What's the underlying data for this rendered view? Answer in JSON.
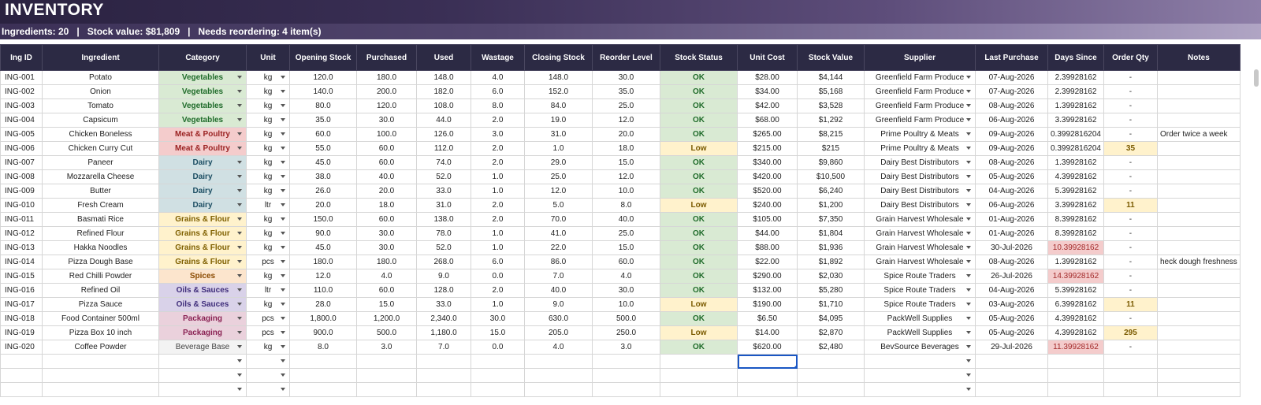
{
  "header": {
    "title": "INVENTORY",
    "summary": "Ingredients: 20   |   Stock value: $81,809   |   Needs reordering: 4 item(s)"
  },
  "columns": [
    "Ing ID",
    "Ingredient",
    "Category",
    "Unit",
    "Opening Stock",
    "Purchased",
    "Used",
    "Wastage",
    "Closing Stock",
    "Reorder Level",
    "Stock Status",
    "Unit Cost",
    "Stock Value",
    "Supplier",
    "Last Purchase",
    "Days Since",
    "Order Qty",
    "Notes"
  ],
  "rows": [
    {
      "id": "ING-001",
      "name": "Potato",
      "category": "Vegetables",
      "unit": "kg",
      "opening": "120.0",
      "purchased": "180.0",
      "used": "148.0",
      "wastage": "4.0",
      "closing": "148.0",
      "reorder": "30.0",
      "status": "OK",
      "cost": "$28.00",
      "value": "$4,144",
      "supplier": "Greenfield Farm Produce",
      "last": "07-Aug-2026",
      "days": "2.39928162",
      "order": "-",
      "notes": ""
    },
    {
      "id": "ING-002",
      "name": "Onion",
      "category": "Vegetables",
      "unit": "kg",
      "opening": "140.0",
      "purchased": "200.0",
      "used": "182.0",
      "wastage": "6.0",
      "closing": "152.0",
      "reorder": "35.0",
      "status": "OK",
      "cost": "$34.00",
      "value": "$5,168",
      "supplier": "Greenfield Farm Produce",
      "last": "07-Aug-2026",
      "days": "2.39928162",
      "order": "-",
      "notes": ""
    },
    {
      "id": "ING-003",
      "name": "Tomato",
      "category": "Vegetables",
      "unit": "kg",
      "opening": "80.0",
      "purchased": "120.0",
      "used": "108.0",
      "wastage": "8.0",
      "closing": "84.0",
      "reorder": "25.0",
      "status": "OK",
      "cost": "$42.00",
      "value": "$3,528",
      "supplier": "Greenfield Farm Produce",
      "last": "08-Aug-2026",
      "days": "1.39928162",
      "order": "-",
      "notes": ""
    },
    {
      "id": "ING-004",
      "name": "Capsicum",
      "category": "Vegetables",
      "unit": "kg",
      "opening": "35.0",
      "purchased": "30.0",
      "used": "44.0",
      "wastage": "2.0",
      "closing": "19.0",
      "reorder": "12.0",
      "status": "OK",
      "cost": "$68.00",
      "value": "$1,292",
      "supplier": "Greenfield Farm Produce",
      "last": "06-Aug-2026",
      "days": "3.39928162",
      "order": "-",
      "notes": ""
    },
    {
      "id": "ING-005",
      "name": "Chicken Boneless",
      "category": "Meat & Poultry",
      "unit": "kg",
      "opening": "60.0",
      "purchased": "100.0",
      "used": "126.0",
      "wastage": "3.0",
      "closing": "31.0",
      "reorder": "20.0",
      "status": "OK",
      "cost": "$265.00",
      "value": "$8,215",
      "supplier": "Prime Poultry & Meats",
      "last": "09-Aug-2026",
      "days": "0.3992816204",
      "order": "-",
      "notes": "Order twice a week"
    },
    {
      "id": "ING-006",
      "name": "Chicken Curry Cut",
      "category": "Meat & Poultry",
      "unit": "kg",
      "opening": "55.0",
      "purchased": "60.0",
      "used": "112.0",
      "wastage": "2.0",
      "closing": "1.0",
      "reorder": "18.0",
      "status": "Low",
      "cost": "$215.00",
      "value": "$215",
      "supplier": "Prime Poultry & Meats",
      "last": "09-Aug-2026",
      "days": "0.3992816204",
      "order": "35",
      "notes": ""
    },
    {
      "id": "ING-007",
      "name": "Paneer",
      "category": "Dairy",
      "unit": "kg",
      "opening": "45.0",
      "purchased": "60.0",
      "used": "74.0",
      "wastage": "2.0",
      "closing": "29.0",
      "reorder": "15.0",
      "status": "OK",
      "cost": "$340.00",
      "value": "$9,860",
      "supplier": "Dairy Best Distributors",
      "last": "08-Aug-2026",
      "days": "1.39928162",
      "order": "-",
      "notes": ""
    },
    {
      "id": "ING-008",
      "name": "Mozzarella Cheese",
      "category": "Dairy",
      "unit": "kg",
      "opening": "38.0",
      "purchased": "40.0",
      "used": "52.0",
      "wastage": "1.0",
      "closing": "25.0",
      "reorder": "12.0",
      "status": "OK",
      "cost": "$420.00",
      "value": "$10,500",
      "supplier": "Dairy Best Distributors",
      "last": "05-Aug-2026",
      "days": "4.39928162",
      "order": "-",
      "notes": ""
    },
    {
      "id": "ING-009",
      "name": "Butter",
      "category": "Dairy",
      "unit": "kg",
      "opening": "26.0",
      "purchased": "20.0",
      "used": "33.0",
      "wastage": "1.0",
      "closing": "12.0",
      "reorder": "10.0",
      "status": "OK",
      "cost": "$520.00",
      "value": "$6,240",
      "supplier": "Dairy Best Distributors",
      "last": "04-Aug-2026",
      "days": "5.39928162",
      "order": "-",
      "notes": ""
    },
    {
      "id": "ING-010",
      "name": "Fresh Cream",
      "category": "Dairy",
      "unit": "ltr",
      "opening": "20.0",
      "purchased": "18.0",
      "used": "31.0",
      "wastage": "2.0",
      "closing": "5.0",
      "reorder": "8.0",
      "status": "Low",
      "cost": "$240.00",
      "value": "$1,200",
      "supplier": "Dairy Best Distributors",
      "last": "06-Aug-2026",
      "days": "3.39928162",
      "order": "11",
      "notes": ""
    },
    {
      "id": "ING-011",
      "name": "Basmati Rice",
      "category": "Grains & Flour",
      "unit": "kg",
      "opening": "150.0",
      "purchased": "60.0",
      "used": "138.0",
      "wastage": "2.0",
      "closing": "70.0",
      "reorder": "40.0",
      "status": "OK",
      "cost": "$105.00",
      "value": "$7,350",
      "supplier": "Grain Harvest Wholesale",
      "last": "01-Aug-2026",
      "days": "8.39928162",
      "order": "-",
      "notes": ""
    },
    {
      "id": "ING-012",
      "name": "Refined Flour",
      "category": "Grains & Flour",
      "unit": "kg",
      "opening": "90.0",
      "purchased": "30.0",
      "used": "78.0",
      "wastage": "1.0",
      "closing": "41.0",
      "reorder": "25.0",
      "status": "OK",
      "cost": "$44.00",
      "value": "$1,804",
      "supplier": "Grain Harvest Wholesale",
      "last": "01-Aug-2026",
      "days": "8.39928162",
      "order": "-",
      "notes": ""
    },
    {
      "id": "ING-013",
      "name": "Hakka Noodles",
      "category": "Grains & Flour",
      "unit": "kg",
      "opening": "45.0",
      "purchased": "30.0",
      "used": "52.0",
      "wastage": "1.0",
      "closing": "22.0",
      "reorder": "15.0",
      "status": "OK",
      "cost": "$88.00",
      "value": "$1,936",
      "supplier": "Grain Harvest Wholesale",
      "last": "30-Jul-2026",
      "days": "10.39928162",
      "order": "-",
      "notes": ""
    },
    {
      "id": "ING-014",
      "name": "Pizza Dough Base",
      "category": "Grains & Flour",
      "unit": "pcs",
      "opening": "180.0",
      "purchased": "180.0",
      "used": "268.0",
      "wastage": "6.0",
      "closing": "86.0",
      "reorder": "60.0",
      "status": "OK",
      "cost": "$22.00",
      "value": "$1,892",
      "supplier": "Grain Harvest Wholesale",
      "last": "08-Aug-2026",
      "days": "1.39928162",
      "order": "-",
      "notes": "heck dough freshness"
    },
    {
      "id": "ING-015",
      "name": "Red Chilli Powder",
      "category": "Spices",
      "unit": "kg",
      "opening": "12.0",
      "purchased": "4.0",
      "used": "9.0",
      "wastage": "0.0",
      "closing": "7.0",
      "reorder": "4.0",
      "status": "OK",
      "cost": "$290.00",
      "value": "$2,030",
      "supplier": "Spice Route Traders",
      "last": "26-Jul-2026",
      "days": "14.39928162",
      "order": "-",
      "notes": ""
    },
    {
      "id": "ING-016",
      "name": "Refined Oil",
      "category": "Oils & Sauces",
      "unit": "ltr",
      "opening": "110.0",
      "purchased": "60.0",
      "used": "128.0",
      "wastage": "2.0",
      "closing": "40.0",
      "reorder": "30.0",
      "status": "OK",
      "cost": "$132.00",
      "value": "$5,280",
      "supplier": "Spice Route Traders",
      "last": "04-Aug-2026",
      "days": "5.39928162",
      "order": "-",
      "notes": ""
    },
    {
      "id": "ING-017",
      "name": "Pizza Sauce",
      "category": "Oils & Sauces",
      "unit": "kg",
      "opening": "28.0",
      "purchased": "15.0",
      "used": "33.0",
      "wastage": "1.0",
      "closing": "9.0",
      "reorder": "10.0",
      "status": "Low",
      "cost": "$190.00",
      "value": "$1,710",
      "supplier": "Spice Route Traders",
      "last": "03-Aug-2026",
      "days": "6.39928162",
      "order": "11",
      "notes": ""
    },
    {
      "id": "ING-018",
      "name": "Food Container 500ml",
      "category": "Packaging",
      "unit": "pcs",
      "opening": "1,800.0",
      "purchased": "1,200.0",
      "used": "2,340.0",
      "wastage": "30.0",
      "closing": "630.0",
      "reorder": "500.0",
      "status": "OK",
      "cost": "$6.50",
      "value": "$4,095",
      "supplier": "PackWell Supplies",
      "last": "05-Aug-2026",
      "days": "4.39928162",
      "order": "-",
      "notes": ""
    },
    {
      "id": "ING-019",
      "name": "Pizza Box 10 inch",
      "category": "Packaging",
      "unit": "pcs",
      "opening": "900.0",
      "purchased": "500.0",
      "used": "1,180.0",
      "wastage": "15.0",
      "closing": "205.0",
      "reorder": "250.0",
      "status": "Low",
      "cost": "$14.00",
      "value": "$2,870",
      "supplier": "PackWell Supplies",
      "last": "05-Aug-2026",
      "days": "4.39928162",
      "order": "295",
      "notes": ""
    },
    {
      "id": "ING-020",
      "name": "Coffee Powder",
      "category": "Beverage Base",
      "unit": "kg",
      "opening": "8.0",
      "purchased": "3.0",
      "used": "7.0",
      "wastage": "0.0",
      "closing": "4.0",
      "reorder": "3.0",
      "status": "OK",
      "cost": "$620.00",
      "value": "$2,480",
      "supplier": "BevSource Beverages",
      "last": "29-Jul-2026",
      "days": "11.39928162",
      "order": "-",
      "notes": ""
    }
  ],
  "empty_rows": 3,
  "selected_cell": {
    "row": 1,
    "column": "Unit Cost"
  },
  "colors": {
    "header_bg": "#2c2a44",
    "ok": "#d9ead3",
    "low": "#fff2cc",
    "overdue": "#f4cccc",
    "selection": "#1a56c4"
  },
  "icons": {
    "dropdown": "chevron-down-icon"
  }
}
